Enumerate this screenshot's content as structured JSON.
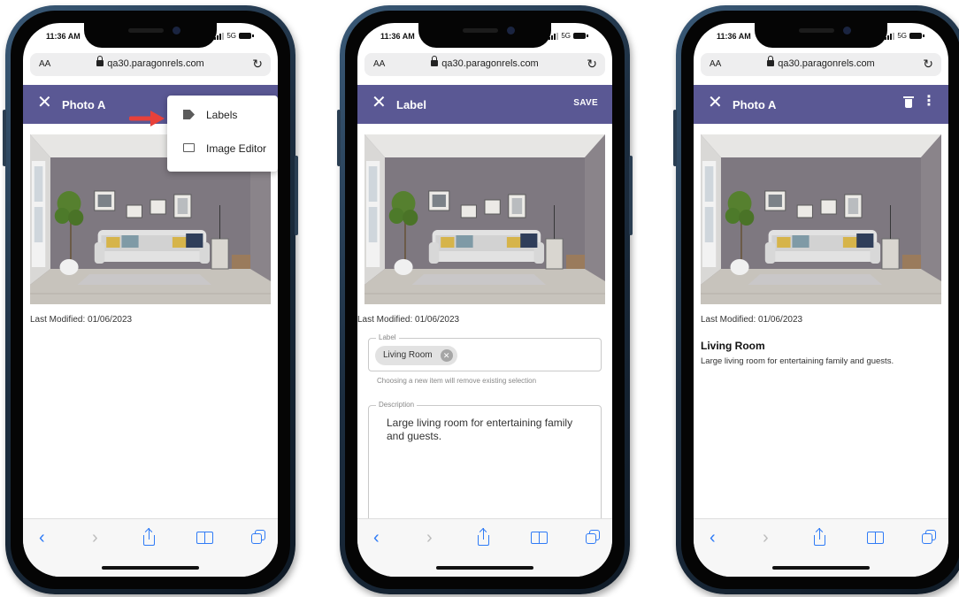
{
  "status": {
    "time": "11:36 AM",
    "network": "5G"
  },
  "browser": {
    "text_size": "AA",
    "url": "qa30.paragonrels.com",
    "reload_icon": "reload-icon"
  },
  "phones": [
    {
      "header_title": "Photo A",
      "menu": {
        "items": [
          {
            "label": "Labels",
            "icon": "tag-icon"
          },
          {
            "label": "Image Editor",
            "icon": "image-editor-icon"
          }
        ]
      },
      "last_modified": "Last Modified: 01/06/2023"
    },
    {
      "header_title": "Label",
      "save_label": "SAVE",
      "last_modified": "Last Modified: 01/06/2023",
      "label_field": {
        "label": "Label",
        "chip": "Living Room",
        "helper": "Choosing a new item will remove existing selection"
      },
      "description_field": {
        "label": "Description",
        "value": "Large living room for entertaining family and guests."
      }
    },
    {
      "header_title": "Photo A",
      "last_modified": "Last Modified: 01/06/2023",
      "label_title": "Living Room",
      "label_description": "Large living room for entertaining family and guests."
    }
  ],
  "colors": {
    "app_bar": "#5a5894",
    "safari_blue": "#2f7bf6",
    "arrow_red": "#e8413a",
    "frame": "#1c2d3f"
  }
}
